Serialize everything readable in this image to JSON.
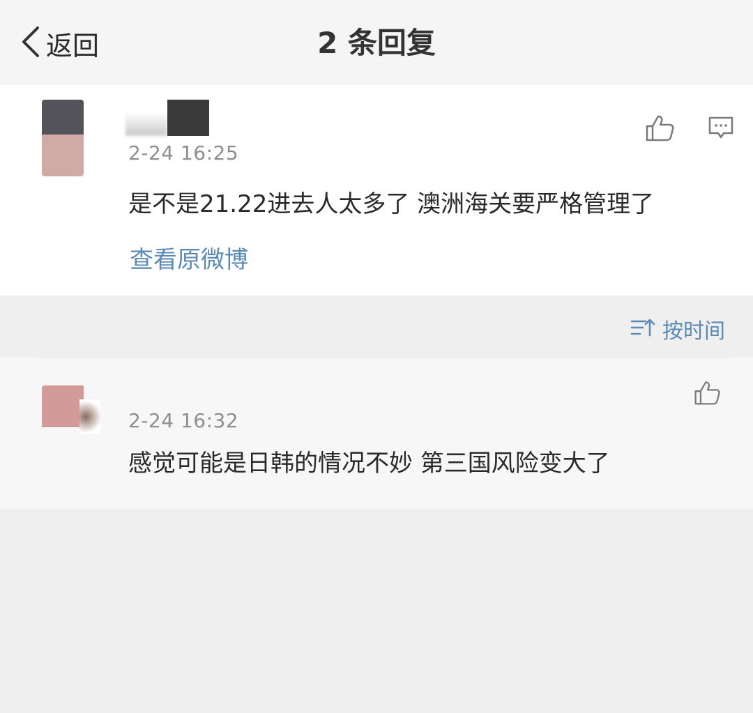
{
  "nav": {
    "back_label": "返回",
    "title": "2 条回复"
  },
  "main_comment": {
    "time": "2-24 16:25",
    "text": "是不是21.22进去人太多了 澳洲海关要严格管理了",
    "view_original": "查看原微博"
  },
  "sort": {
    "label": "按时间"
  },
  "reply": {
    "time": "2-24 16:32",
    "text": "感觉可能是日韩的情况不妙 第三国风险变大了"
  },
  "colors": {
    "link": "#5b8bb5",
    "text": "#2a2a2a",
    "meta": "#8e8e8e",
    "icon": "#7a7a7a"
  }
}
